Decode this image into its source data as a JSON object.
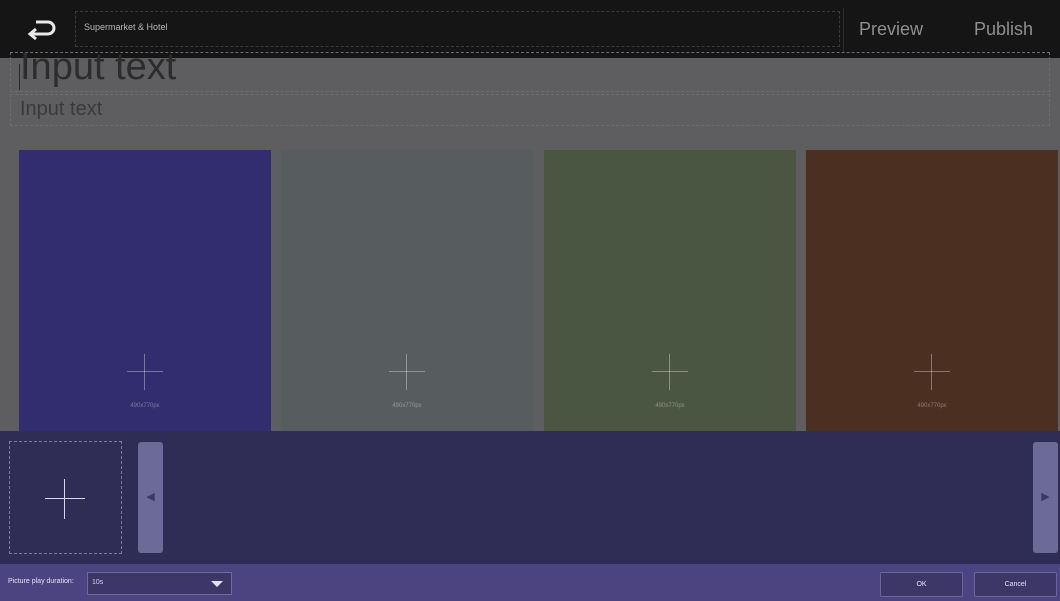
{
  "header": {
    "back_icon": "return-arrow-icon",
    "title": "Supermarket & Hotel",
    "preview_label": "Preview",
    "publish_label": "Publish"
  },
  "editor": {
    "headline": "Input text",
    "subline": "Input text"
  },
  "tiles": [
    {
      "color": "#312d6e",
      "size_label": "490x770px"
    },
    {
      "color": "#575d5e",
      "size_label": "490x770px"
    },
    {
      "color": "#4a5642",
      "size_label": "490x770px"
    },
    {
      "color": "#4b2f20",
      "size_label": "490x770px"
    }
  ],
  "panel": {
    "add_icon": "plus-icon",
    "left_arrow_icon": "triangle-left-icon",
    "right_arrow_icon": "triangle-right-icon"
  },
  "footer": {
    "duration_label": "Picture play duration:",
    "duration_value": "10s",
    "ok_label": "OK",
    "cancel_label": "Cancel"
  }
}
